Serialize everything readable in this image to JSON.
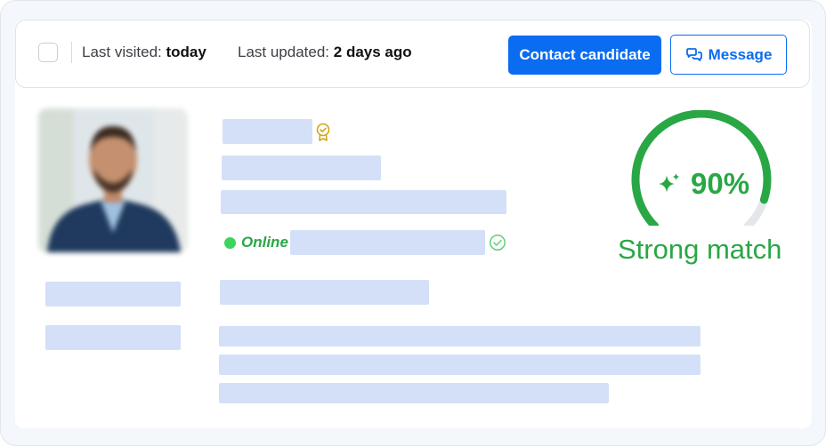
{
  "header": {
    "last_visited_label": "Last visited:",
    "last_visited_value": "today",
    "last_updated_label": "Last updated:",
    "last_updated_value": "2 days ago",
    "contact_button": "Contact candidate",
    "message_button": "Message"
  },
  "profile": {
    "status": "Online",
    "status_color": "#29a745",
    "verified_icon": "award-badge-icon",
    "check_icon": "check-circle-icon"
  },
  "match": {
    "percent": 90,
    "percent_text": "90%",
    "label": "Strong match",
    "color": "#29a745",
    "track_color": "#e3e6ea"
  },
  "colors": {
    "primary": "#0a6cf0",
    "placeholder": "#d3e0f7"
  }
}
